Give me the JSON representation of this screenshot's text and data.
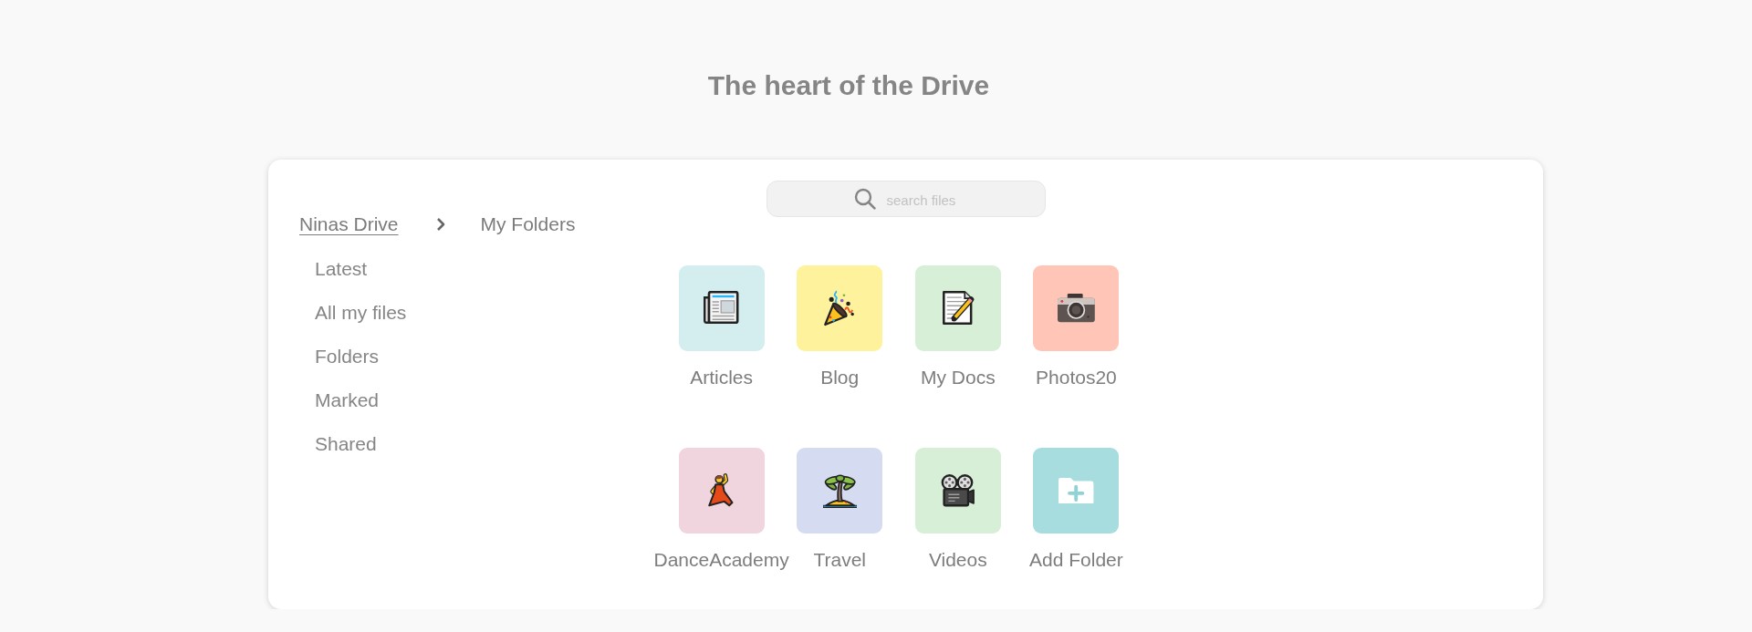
{
  "title": "The heart of the Drive",
  "breadcrumb": {
    "root": "Ninas Drive",
    "current": "My Folders"
  },
  "nav": [
    {
      "label": "Latest",
      "selected": false
    },
    {
      "label": "All my files",
      "selected": false
    },
    {
      "label": "Folders",
      "selected": false
    },
    {
      "label": "Marked",
      "selected": false
    },
    {
      "label": "Shared",
      "selected": false
    }
  ],
  "search": {
    "placeholder": "search files"
  },
  "folders": [
    {
      "kind": "folder",
      "label": "Articles",
      "color": "#d4eef0"
    },
    {
      "kind": "folder",
      "label": "Blog",
      "color": "#fff29c"
    },
    {
      "kind": "folder",
      "label": "My Docs",
      "color": "#d6efd6"
    },
    {
      "kind": "folder",
      "label": "Photos20",
      "color": "#ffc6b8"
    },
    {
      "kind": "folder",
      "label": "DanceAcademy",
      "color": "#f0d4de"
    },
    {
      "kind": "folder",
      "label": "Travel",
      "color": "#d5dbf0"
    },
    {
      "kind": "folder",
      "label": "Videos",
      "color": "#d6efd6"
    },
    {
      "kind": "add",
      "label": "Add Folder",
      "color": "#a8dde0"
    }
  ]
}
